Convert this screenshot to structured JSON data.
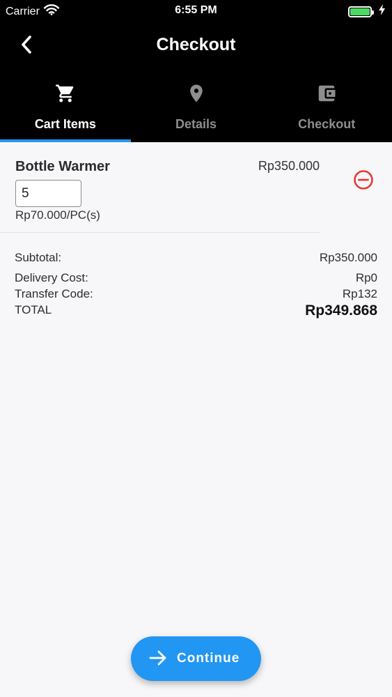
{
  "status_bar": {
    "carrier": "Carrier",
    "time": "6:55 PM",
    "icons": [
      "wifi-icon",
      "battery-icon",
      "charging-icon"
    ],
    "battery_color": "#4cd964"
  },
  "app_bar": {
    "title": "Checkout",
    "back_icon": "chevron-left-icon"
  },
  "tabs": [
    {
      "label": "Cart Items",
      "icon": "cart-icon",
      "active": true
    },
    {
      "label": "Details",
      "icon": "location-pin-icon",
      "active": false
    },
    {
      "label": "Checkout",
      "icon": "wallet-icon",
      "active": false
    }
  ],
  "cart": {
    "items": [
      {
        "name": "Bottle Warmer",
        "price": "Rp350.000",
        "quantity": "5",
        "unit_price": "Rp70.000/PC(s)",
        "remove_icon": "remove-circle-icon"
      }
    ]
  },
  "summary": {
    "subtotal_label": "Subtotal:",
    "subtotal_value": "Rp350.000",
    "delivery_label": "Delivery Cost:",
    "delivery_value": "Rp0",
    "transfer_label": "Transfer Code:",
    "transfer_value": "Rp132",
    "total_label": "TOTAL",
    "total_value": "Rp349.868"
  },
  "footer": {
    "continue_label": "Continue",
    "continue_icon": "arrow-right-icon"
  },
  "colors": {
    "accent": "#2196f3",
    "header_bg": "#000000",
    "remove": "#e53935",
    "inactive_tab": "#8e8e8e"
  }
}
